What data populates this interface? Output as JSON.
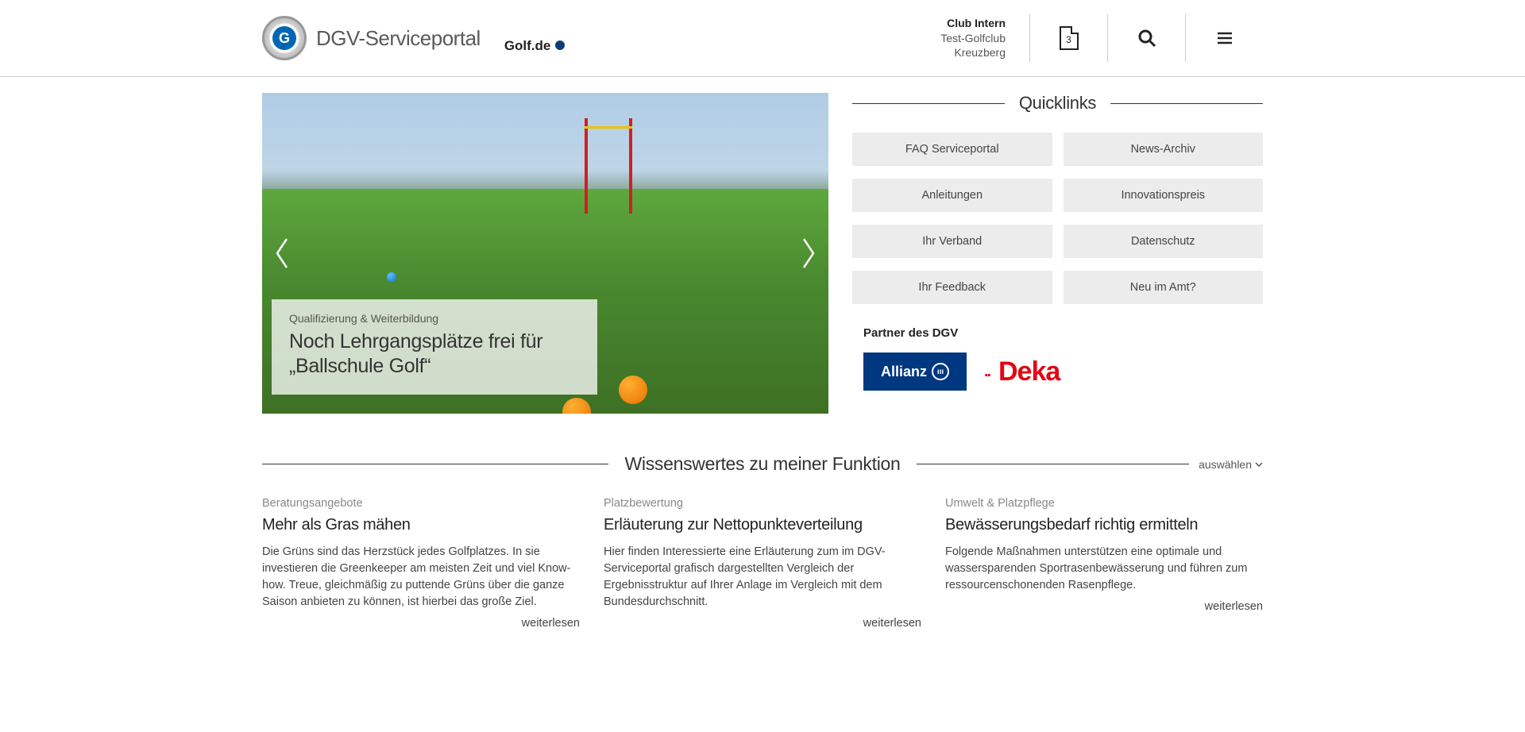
{
  "header": {
    "portal_title": "DGV-Serviceportal",
    "golfde": "Golf.de",
    "club": {
      "label": "Club Intern",
      "name": "Test-Golfclub",
      "loc": "Kreuzberg"
    },
    "doc_count": "3"
  },
  "hero": {
    "category": "Qualifizierung & Weiterbildung",
    "title": "Noch Lehrgangsplätze frei für „Ballschule Golf“"
  },
  "quicklinks": {
    "title": "Quicklinks",
    "items": [
      "FAQ Serviceportal",
      "News-Archiv",
      "Anleitungen",
      "Innovationspreis",
      "Ihr Verband",
      "Datenschutz",
      "Ihr Feedback",
      "Neu im Amt?"
    ]
  },
  "partners": {
    "title": "Partner des DGV",
    "allianz": "Allianz",
    "deka": "Deka"
  },
  "knowhow": {
    "heading": "Wissenswertes zu meiner Funktion",
    "select": "auswählen",
    "readmore": "weiterlesen",
    "articles": [
      {
        "cat": "Beratungsangebote",
        "title": "Mehr als Gras mähen",
        "body": "Die Grüns sind das Herzstück jedes Golfplatzes. In sie investieren die Greenkeeper am meisten Zeit und viel Know-how. Treue, gleichmäßig zu puttende Grüns über die ganze Saison anbieten zu können, ist hierbei das große Ziel."
      },
      {
        "cat": "Platzbewertung",
        "title": "Erläuterung zur Nettopunkteverteilung",
        "body": "Hier finden Interessierte eine Erläuterung zum im DGV-Serviceportal grafisch dargestellten Vergleich der Ergebnisstruktur auf Ihrer Anlage im Vergleich mit dem Bundesdurchschnitt."
      },
      {
        "cat": "Umwelt & Platzpflege",
        "title": "Bewässerungsbedarf richtig ermitteln",
        "body": "Folgende Maßnahmen unterstützen eine optimale und wassersparenden Sportrasenbewässerung und führen zum ressourcenschonenden Rasenpflege."
      }
    ]
  }
}
